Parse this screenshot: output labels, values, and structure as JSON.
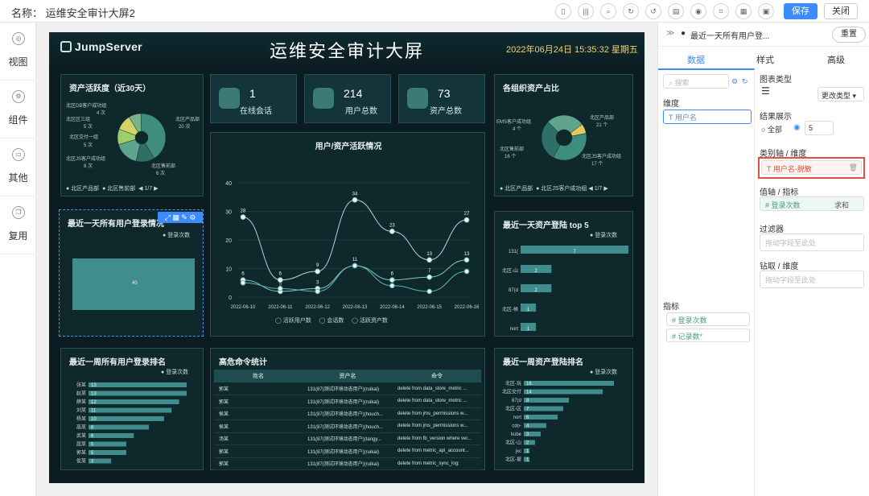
{
  "topbar": {
    "title": "名称： 运维安全审计大屏2",
    "icons": [
      "phone-icon",
      "barcode-icon",
      "zoom-icon",
      "refresh-icon",
      "undo-icon",
      "file-icon",
      "eye-icon",
      "scan-icon",
      "grid-icon",
      "apps-icon"
    ],
    "save_label": "保存",
    "close_label": "关闭"
  },
  "leftnav": {
    "items": [
      {
        "label": "视图",
        "icon": "view-icon"
      },
      {
        "label": "组件",
        "icon": "component-icon"
      },
      {
        "label": "其他",
        "icon": "other-icon"
      },
      {
        "label": "复用",
        "icon": "reuse-icon"
      }
    ]
  },
  "screen": {
    "logo": "JumpServer",
    "title": "运维安全审计大屏",
    "datetime": "2022年06月24日 15:35:32 星期五",
    "kpis": [
      {
        "value": "1",
        "label": "在线会话"
      },
      {
        "value": "214",
        "label": "用户总数"
      },
      {
        "value": "73",
        "label": "资产总数"
      }
    ],
    "activity": {
      "title": "资产活跃度（近30天）",
      "labels": [
        "北区DB客户成功组",
        "4 次",
        "北区区三组",
        "5 次",
        "北区交付一组",
        "5 次",
        "北区JS客户成功组",
        "8 次",
        "北区产品部",
        "20 次",
        "北区售前部",
        "6 次"
      ],
      "legend": [
        "北区产品部",
        "北区售前部"
      ],
      "pager": "1/7"
    },
    "org_share": {
      "title": "各组织资产占比",
      "labels": [
        "EMS客户成功组",
        "4 个",
        "北区产品部",
        "21 个",
        "北区售前部",
        "16 个",
        "北区JS客户成功组",
        "17 个"
      ],
      "legend": [
        "北区产品部",
        "北区JS客户成功组"
      ],
      "pager": "1/7"
    },
    "line_title": "用户/资产活跃情况",
    "line_legend": [
      "活跃用户数",
      "会话数",
      "活跃资产数"
    ],
    "login_day": {
      "title": "最近一天所有用户登录情况",
      "legend": "登录次数",
      "value_label": "40"
    },
    "asset_top5": {
      "title": "最近一天资产登陆 top 5",
      "legend": "登录次数"
    },
    "week_user": {
      "title": "最近一周所有用户登录排名",
      "legend": "登录次数"
    },
    "week_asset": {
      "title": "最近一周资产登陆排名",
      "legend": "登录次数"
    },
    "cmd_table": {
      "title": "高危命令统计",
      "headers": [
        "姓名",
        "资产名",
        "命令"
      ],
      "rows": [
        [
          "郭某",
          "131(87(测试环境动态用户)(ruikai)",
          "delete from data_store_metric ..."
        ],
        [
          "郭某",
          "131(87(测试环境动态用户)(ruikai)",
          "delete from data_store_metric ..."
        ],
        [
          "侯某",
          "131(87(测试环境动态用户)(houch...",
          "delete from jms_permissions w..."
        ],
        [
          "侯某",
          "131(87(测试环境动态用户)(houch...",
          "delete from jms_permissions w..."
        ],
        [
          "汤某",
          "131(87(测试环境动态用户)(tangy...",
          "delete from fb_version where ver..."
        ],
        [
          "郭某",
          "131(87(测试环境动态用户)(ruikai)",
          "delete from metric_api_account..."
        ],
        [
          "郭某",
          "131(87(测试环境动态用户)(ruikai)",
          "delete from metric_sync_log;"
        ]
      ]
    }
  },
  "chart_data": [
    {
      "type": "line",
      "title": "用户/资产活跃情况",
      "x": [
        "2022-06-10",
        "2022-06-11",
        "2022-06-12",
        "2022-06-13",
        "2022-06-14",
        "2022-06-15",
        "2022-06-16"
      ],
      "ylim": [
        0,
        40
      ],
      "yticks": [
        0,
        10,
        20,
        30,
        40
      ],
      "series": [
        {
          "name": "活跃用户数",
          "values": [
            28,
            6,
            9,
            34,
            23,
            13,
            27
          ]
        },
        {
          "name": "会话数",
          "values": [
            6,
            2,
            3,
            11,
            6,
            7,
            13
          ]
        },
        {
          "name": "活跃资产数",
          "values": [
            5,
            3,
            2,
            11,
            4,
            2,
            9
          ]
        }
      ]
    },
    {
      "type": "bar",
      "title": "最近一天所有用户登录情况",
      "categories": [
        ""
      ],
      "values": [
        40
      ]
    },
    {
      "type": "bar",
      "title": "最近一天资产登陆 top 5",
      "categories": [
        "131(",
        "北区-山",
        "87(d",
        "北区-候",
        "nort"
      ],
      "values": [
        7,
        2,
        2,
        1,
        1
      ]
    },
    {
      "type": "bar",
      "title": "最近一周所有用户登录排名",
      "categories": [
        "张某",
        "赵某",
        "薛某",
        "刘某",
        "杨某",
        "高某",
        "武某",
        "屈某",
        "郭某",
        "侯某"
      ],
      "values": [
        13,
        13,
        12,
        11,
        10,
        8,
        6,
        5,
        5,
        3
      ]
    },
    {
      "type": "bar",
      "title": "最近一周资产登陆排名",
      "categories": [
        "北区-玩",
        "北区交付",
        "87(d",
        "北区-区",
        "nort",
        "cdo-",
        "kube",
        "北区-山",
        "jxc",
        "北区-振"
      ],
      "values": [
        16,
        14,
        8,
        7,
        6,
        4,
        3,
        2,
        1,
        1
      ]
    },
    {
      "type": "pie",
      "title": "资产活跃度（近30天）",
      "categories": [
        "北区产品部",
        "北区售前部",
        "北区JS客户成功组",
        "北区交付一组",
        "北区区三组",
        "北区DB客户成功组"
      ],
      "values": [
        20,
        6,
        8,
        5,
        5,
        4
      ]
    },
    {
      "type": "pie",
      "title": "各组织资产占比",
      "categories": [
        "北区产品部",
        "北区JS客户成功组",
        "北区售前部",
        "EMS客户成功组"
      ],
      "values": [
        21,
        17,
        16,
        4
      ]
    }
  ],
  "rightpanel": {
    "header": "最近一天所有用户登...",
    "reset_label": "重置",
    "tabs": [
      "数据",
      "样式",
      "高级"
    ],
    "search_placeholder": "搜索",
    "dimension_title": "维度",
    "dimension_field": "用户名",
    "metric_title": "指标",
    "metrics": [
      "登录次数",
      "记录数*"
    ],
    "chart_type_label": "图表类型",
    "change_type_label": "更改类型",
    "result_label": "结果展示",
    "all_label": "全部",
    "result_count": "5",
    "category_axis_label": "类别轴 / 维度",
    "category_field": "用户名-脱敏",
    "value_axis_label": "值轴 / 指标",
    "value_field": "登录次数",
    "value_agg": "求和",
    "filter_label": "过滤器",
    "drag_hint": "拖动字段至此处",
    "drill_label": "钻取 / 维度"
  }
}
